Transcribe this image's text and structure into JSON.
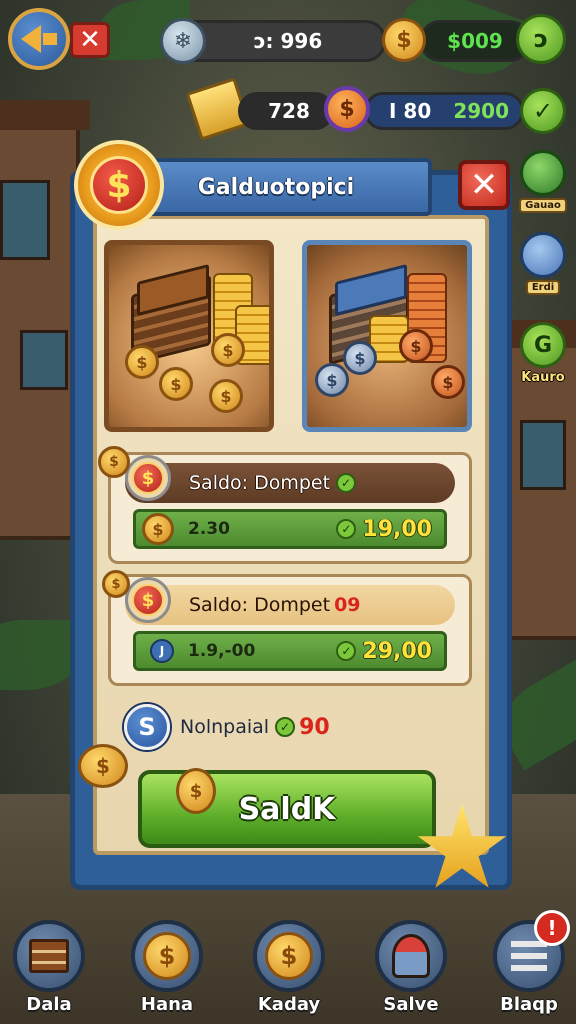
{
  "hud": {
    "gem_value": "ↄ: 996",
    "money_value": "$009",
    "tickets_value": "728",
    "coins_purple_value": "I 80",
    "green_value": "2900",
    "coin_symbol": "$",
    "gem_symbol": "❄",
    "back_symbol": "",
    "close_symbol": "✕",
    "green_round_symbol": "ↄ",
    "check_symbol": "✓"
  },
  "side_icons": [
    {
      "label": "Gauao",
      "icon": "dino-icon",
      "color": "#4bb04a"
    },
    {
      "label": "Erdi",
      "icon": "character-icon",
      "color": "#5b8fd0"
    },
    {
      "label": "Kauro",
      "icon": "g-icon",
      "color": "#7ac83a",
      "symbol": "G"
    }
  ],
  "panel": {
    "title": "Galduotopici",
    "badge_symbol": "$",
    "close_symbol": "✕"
  },
  "rows": [
    {
      "header": "Saldo: Dompet",
      "header_tick": "✓",
      "header_extra": "",
      "left_value": "2.30",
      "right_value": "19,00",
      "tick": "✓"
    },
    {
      "header": "Saldo: Dompet",
      "header_tick": "",
      "header_extra": "09",
      "left_value": "1.9,-00",
      "right_value": "29,00",
      "tick": "✓",
      "left_icon_symbol": "J"
    }
  ],
  "total": {
    "symbol": "S",
    "label": "Nolnpaial",
    "tick": "✓",
    "value": "90"
  },
  "main_button": "SaldK",
  "nav": [
    {
      "label": "Dala",
      "icon": "book-icon"
    },
    {
      "label": "Hana",
      "icon": "coin-icon"
    },
    {
      "label": "Kaday",
      "icon": "coin-icon"
    },
    {
      "label": "Salve",
      "icon": "character-icon"
    },
    {
      "label": "Blaqp",
      "icon": "menu-icon"
    }
  ],
  "alert_symbol": "!",
  "colors": {
    "panel_blue": "#2f5f98",
    "button_green": "#5eae2a",
    "accent_gold": "#f2b13a",
    "close_red": "#d63b2f"
  }
}
